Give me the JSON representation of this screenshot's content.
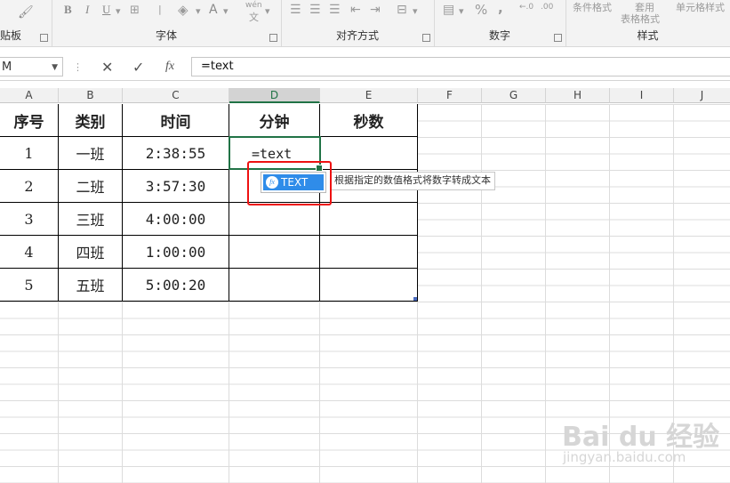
{
  "ribbon": {
    "groups": [
      {
        "label": "贴板"
      },
      {
        "label": "字体"
      },
      {
        "label": "对齐方式"
      },
      {
        "label": "数字"
      },
      {
        "label": "样式"
      }
    ],
    "font_bold": "B",
    "font_italic": "I",
    "font_underline": "U",
    "font_color_letter": "A",
    "wen_top": "wén",
    "wen_bottom": "文",
    "percent": "%",
    "comma": ",",
    "cond_format": "条件格式",
    "apply_top": "套用",
    "table_format": "表格格式",
    "cell_style": "单元格样式"
  },
  "formula_bar": {
    "name_box": "M",
    "cancel_symbol": "✕",
    "enter_symbol": "✓",
    "fx_symbol": "fx",
    "formula": "=text"
  },
  "columns": [
    "A",
    "B",
    "C",
    "D",
    "E",
    "F",
    "G",
    "H",
    "I",
    "J"
  ],
  "table": {
    "headers": [
      "序号",
      "类别",
      "时间",
      "分钟",
      "秒数"
    ],
    "rows": [
      {
        "n": "1",
        "cls": "一班",
        "time": "2:38:55"
      },
      {
        "n": "2",
        "cls": "二班",
        "time": "3:57:30"
      },
      {
        "n": "3",
        "cls": "三班",
        "time": "4:00:00"
      },
      {
        "n": "4",
        "cls": "四班",
        "time": "1:00:00"
      },
      {
        "n": "5",
        "cls": "五班",
        "time": "5:00:20"
      }
    ]
  },
  "active_cell_text": "=text",
  "autocomplete": {
    "item": "TEXT",
    "icon_label": "fx"
  },
  "tooltip": "根据指定的数值格式将数字转成文本",
  "watermark": {
    "brand": "Bai du 经验",
    "url": "jingyan.baidu.com"
  },
  "colors": {
    "accent_green": "#217346",
    "highlight_red": "#e11111",
    "autocomplete_blue": "#2f8ce9"
  }
}
